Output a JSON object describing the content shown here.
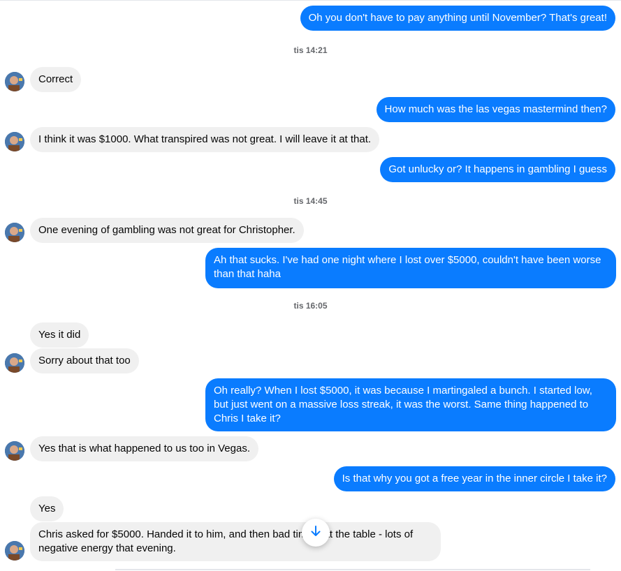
{
  "messages": [
    {
      "text": "Oh you don't have to pay anything until November? That's great!"
    },
    {
      "stamp": "tis 14:21"
    },
    {
      "text": "Correct"
    },
    {
      "text": "How much was the las vegas mastermind then?"
    },
    {
      "text": "I think it was $1000. What transpired was not great. I will leave it at that."
    },
    {
      "text": "Got unlucky or? It happens in gambling I guess"
    },
    {
      "stamp": "tis 14:45"
    },
    {
      "text": "One evening of gambling was not great for Christopher."
    },
    {
      "text": "Ah that sucks. I've had one night where I lost over $5000, couldn't have been worse than that haha"
    },
    {
      "stamp": "tis 16:05"
    },
    {
      "text": "Yes it did"
    },
    {
      "text": "Sorry about that too"
    },
    {
      "text": "Oh really? When I lost $5000, it was because I martingaled a bunch. I started low, but just went on a massive loss streak, it was the worst. Same thing happened to Chris I take it?"
    },
    {
      "text": "Yes that is what happened to us too in Vegas."
    },
    {
      "text": "Is  that why you got a free year in the inner circle I take it?"
    },
    {
      "text": "Yes"
    },
    {
      "text": "Chris asked for $5000. Handed it to him, and then bad timing at the table - lots of negative energy that evening."
    }
  ],
  "colors": {
    "outgoing": "#0a7cff",
    "incoming": "#f0f0f0",
    "accent": "#0a7cff"
  },
  "icons": {
    "scroll": "arrow-down-icon",
    "avatar": "contact-avatar"
  }
}
